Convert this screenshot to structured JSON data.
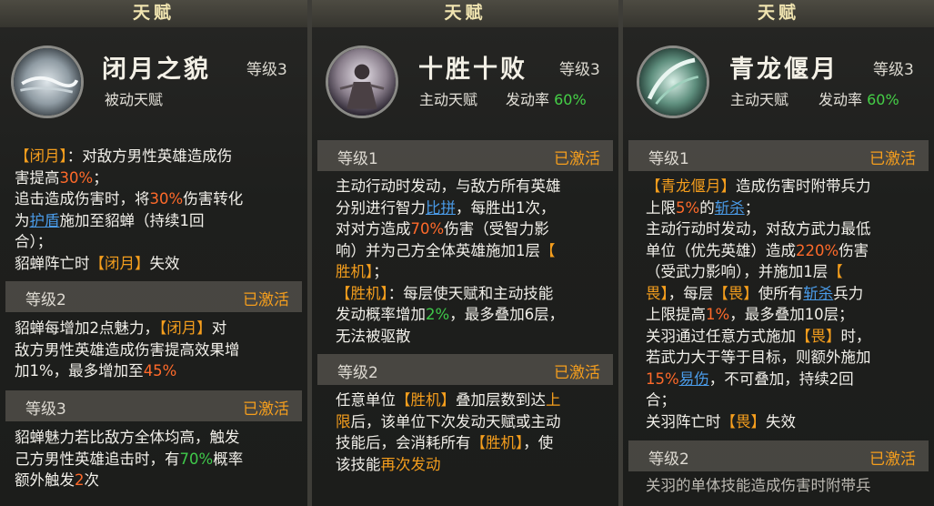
{
  "panels": [
    {
      "header": "天赋",
      "name": "闭月之貌",
      "level": "等级3",
      "type": "被动天赋",
      "lines": [
        [
          "【闭月】：对敌方男性英雄造成伤",
          "害提高30%；",
          "追击造成伤害时，将30%伤害转化",
          "为护盾施加至貂蝉（持续1回",
          "合）；",
          "貂蝉阵亡时【闭月】失效"
        ],
        [
          "貂蝉每增加2点魅力，【闭月】对",
          "敌方男性英雄造成伤害提高效果增",
          "加1%，最多增加至45%"
        ],
        [
          "貂蝉魅力若比敌方全体均高，触发",
          "己方男性英雄追击时，有70%概率",
          "额外触发2次"
        ]
      ],
      "sections": [
        {
          "label": "等级2",
          "status": "已激活"
        },
        {
          "label": "等级3",
          "status": "已激活"
        }
      ]
    },
    {
      "header": "天赋",
      "name": "十胜十败",
      "level": "等级3",
      "type": "主动天赋",
      "rate_label": "发动率",
      "rate_value": "60%",
      "sections": [
        {
          "label": "等级1",
          "status": "已激活"
        },
        {
          "label": "等级2",
          "status": "已激活"
        }
      ],
      "lines": [
        [
          "主动行动时发动，与敌方所有英雄",
          "分别进行智力比拼，每胜出1次，",
          "对对方造成70%伤害（受智力影",
          "响）并为己方全体英雄施加1层【",
          "胜机】；",
          "【胜机】：每层使天赋和主动技能",
          "发动概率增加2%，最多叠加6层，",
          "无法被驱散"
        ],
        [
          "任意单位【胜机】叠加层数到达上",
          "限后，该单位下次发动天赋或主动",
          "技能后，会消耗所有【胜机】，使",
          "该技能再次发动"
        ]
      ]
    },
    {
      "header": "天赋",
      "name": "青龙偃月",
      "level": "等级3",
      "type": "主动天赋",
      "rate_label": "发动率",
      "rate_value": "60%",
      "sections": [
        {
          "label": "等级1",
          "status": "已激活"
        },
        {
          "label": "等级2",
          "status": "已激活"
        }
      ],
      "lines": [
        [
          "【青龙偃月】造成伤害时附带兵力",
          "上限5%的斩杀；",
          "主动行动时发动，对敌方武力最低",
          "单位（优先英雄）造成220%伤害",
          "（受武力影响），并施加1层【",
          "畏】，每层【畏】使所有斩杀兵力",
          "上限提高1%，最多叠加10层；",
          "关羽通过任意方式施加【畏】时，",
          "若武力大于等于目标，则额外施加",
          "15%易伤，不可叠加，持续2回",
          "合；",
          "关羽阵亡时【畏】失效"
        ],
        [
          "关羽的单体技能造成伤害时附带兵"
        ]
      ]
    }
  ]
}
